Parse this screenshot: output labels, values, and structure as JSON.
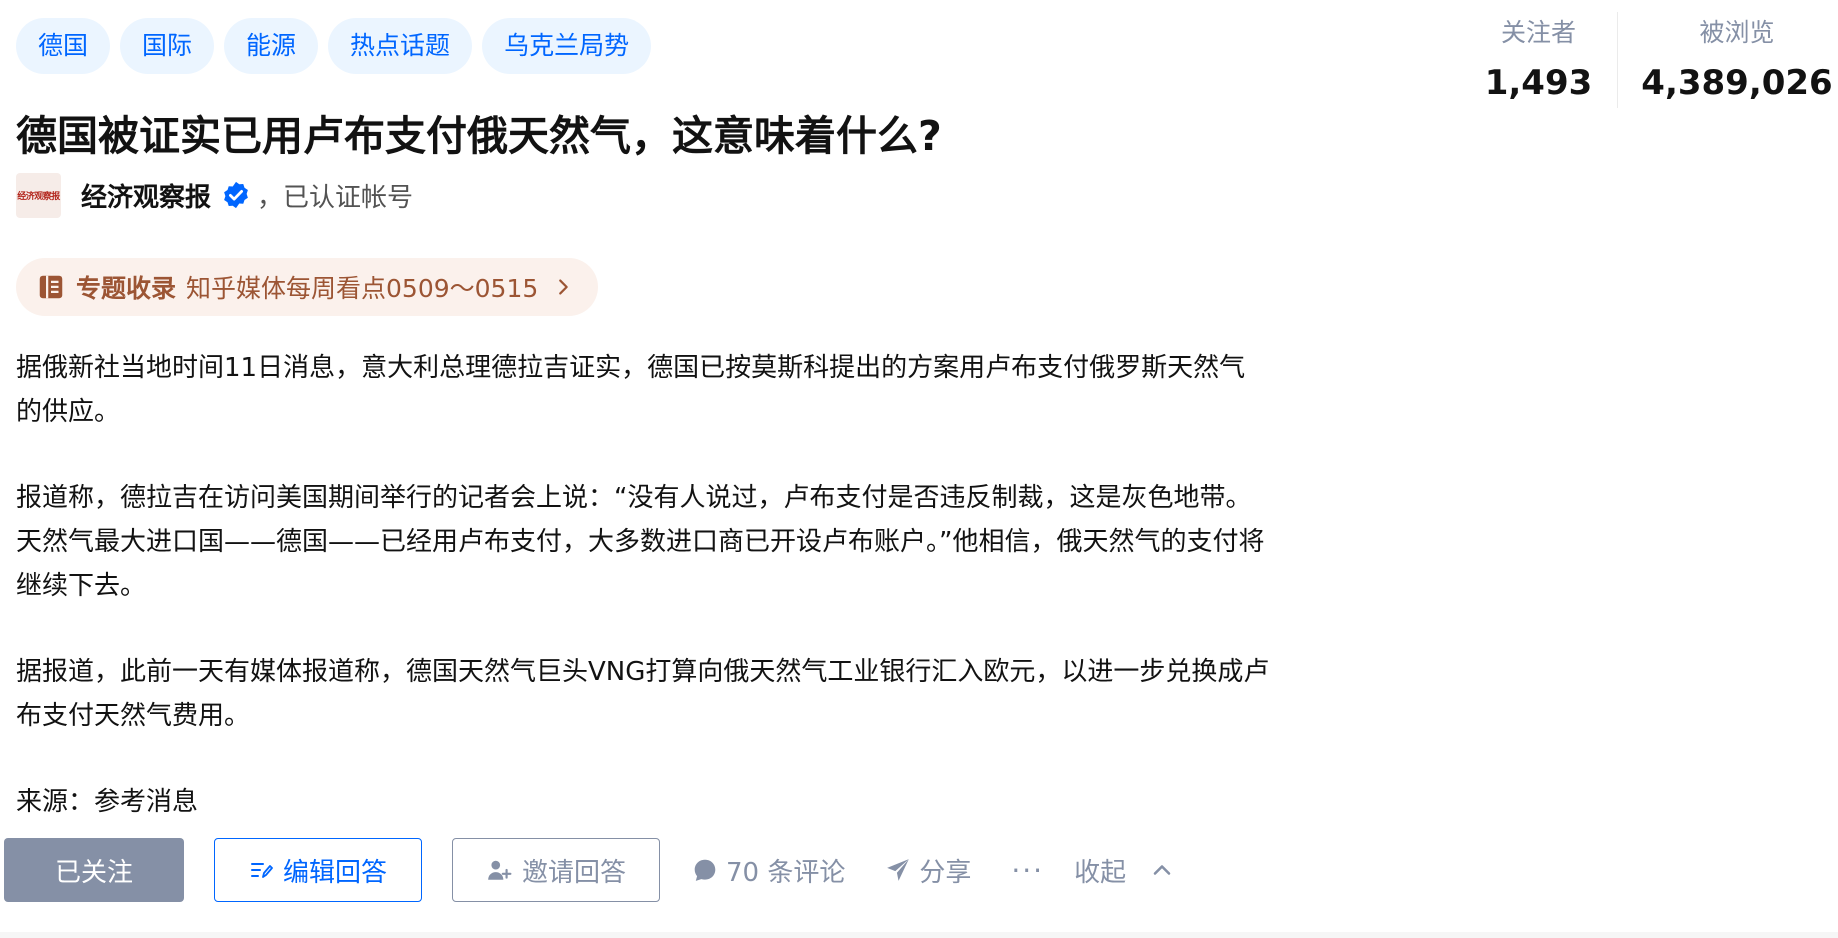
{
  "topics": [
    "德国",
    "国际",
    "能源",
    "热点话题",
    "乌克兰局势"
  ],
  "stats": {
    "followers_label": "关注者",
    "followers_value": "1,493",
    "views_label": "被浏览",
    "views_value": "4,389,026"
  },
  "question": {
    "title": "德国被证实已用卢布支付俄天然气，这意味着什么?"
  },
  "author": {
    "logo_text": "经济观察报",
    "name": "经济观察报",
    "badge": "，已认证帐号"
  },
  "collection": {
    "label": "专题收录",
    "title": "知乎媒体每周看点0509～0515"
  },
  "content": {
    "paragraphs": [
      "据俄新社当地时间11日消息，意大利总理德拉吉证实，德国已按莫斯科提出的方案用卢布支付俄罗斯天然气的供应。",
      "报道称，德拉吉在访问美国期间举行的记者会上说：“没有人说过，卢布支付是否违反制裁，这是灰色地带。天然气最大进口国——德国——已经用卢布支付，大多数进口商已开设卢布账户。”他相信，俄天然气的支付将继续下去。",
      "据报道，此前一天有媒体报道称，德国天然气巨头VNG打算向俄天然气工业银行汇入欧元，以进一步兑换成卢布支付天然气费用。"
    ],
    "source": "来源：参考消息"
  },
  "actions": {
    "followed": "已关注",
    "edit_answer": "编辑回答",
    "invite_answer": "邀请回答",
    "comments": "70 条评论",
    "share": "分享",
    "more": "···",
    "collapse": "收起"
  },
  "colors": {
    "brand_blue": "#0066ff",
    "topic_bg": "#ebf5ff",
    "muted_gray": "#8590a6",
    "collection_brown": "#9c5534",
    "collection_bg": "#fbf1ec"
  },
  "icons": [
    "verified-icon",
    "collection-icon",
    "chevron-right-icon",
    "edit-icon",
    "invite-user-icon",
    "comment-icon",
    "share-icon",
    "more-icon",
    "chevron-up-icon"
  ]
}
